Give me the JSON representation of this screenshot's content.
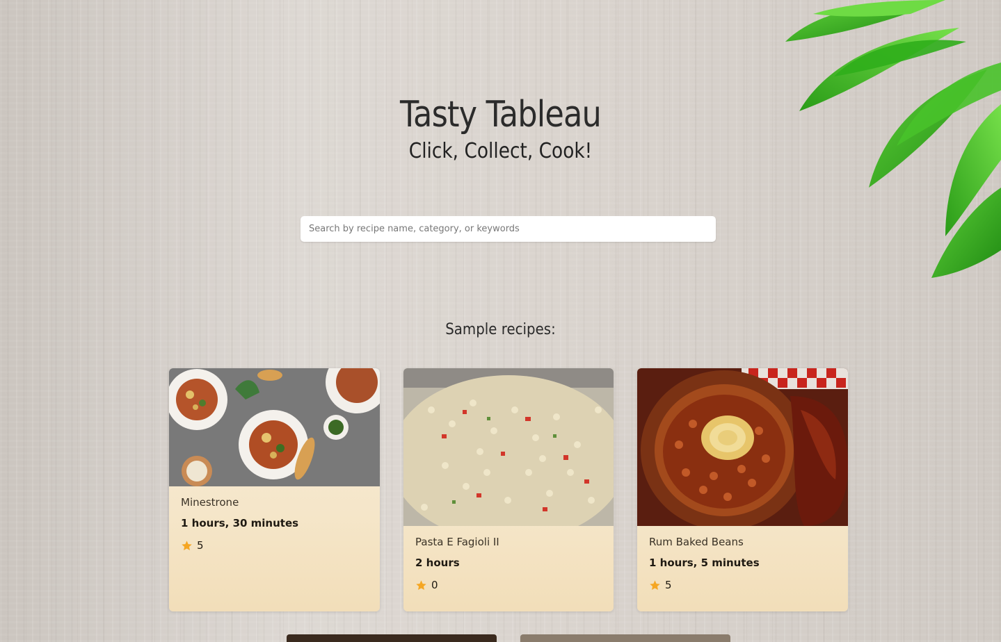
{
  "header": {
    "title": "Tasty Tableau",
    "tagline": "Click, Collect, Cook!"
  },
  "search": {
    "placeholder": "Search by recipe name, category, or keywords",
    "value": ""
  },
  "samples": {
    "heading": "Sample recipes:",
    "cards": [
      {
        "name": "Minestrone",
        "time": "1 hours, 30 minutes",
        "rating": "5",
        "image_icon": "soup-bowls-photo"
      },
      {
        "name": "Pasta E Fagioli II",
        "time": "2 hours",
        "rating": "0",
        "image_icon": "pasta-salad-photo"
      },
      {
        "name": "Rum Baked Beans",
        "time": "1 hours, 5 minutes",
        "rating": "5",
        "image_icon": "baked-beans-photo"
      }
    ]
  },
  "colors": {
    "star": "#f5a623",
    "card_bg": "#f5e6c9",
    "leaf_green": "#3cb521"
  }
}
